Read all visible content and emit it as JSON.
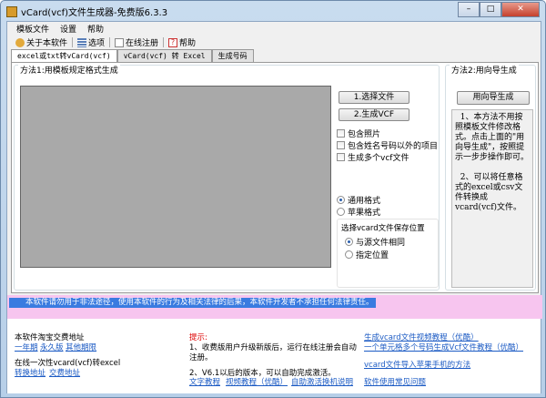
{
  "window": {
    "title": "vCard(vcf)文件生成器-免费版6.3.3",
    "min": "–",
    "max": "□",
    "close": "✕"
  },
  "menu": [
    "模板文件",
    "设置",
    "帮助"
  ],
  "toolbar": [
    "关于本软件",
    "选项",
    "在线注册",
    "帮助"
  ],
  "tabs": [
    "excel或txt转vCard(vcf)",
    "vCard(vcf) 转 Excel",
    "生成号码"
  ],
  "method1": {
    "label": "方法1:用模板规定格式生成",
    "select_file": "1.选择文件",
    "generate": "2.生成VCF",
    "checks": [
      "包含照片",
      "包含姓名号码以外的项目",
      "生成多个vcf文件"
    ],
    "formats": [
      "通用格式",
      "苹果格式"
    ],
    "save_group": "选择vcard文件保存位置",
    "save_opts": [
      "与源文件相同",
      "指定位置"
    ]
  },
  "method2": {
    "label": "方法2:用向导生成",
    "button": "用向导生成",
    "tip": "  1、本方法不用按照模板文件修改格式。点击上面的\"用向导生成\"，按照提示一步步操作即可。\n\n  2、可以将任意格式的excel或csv文件转换成vcard(vcf)文件。"
  },
  "notice": "本软件请勿用于非法途径，使用本软件的行为及相关法律的后果，本软件开发者不承担任何法律责任。",
  "footer": {
    "taobao_label": "本软件淘宝交费地址",
    "taobao_links": [
      "一年期",
      "永久版",
      "其他期限"
    ],
    "online_label": "在线一次性vcard(vcf)转excel",
    "online_links": [
      "转换地址",
      "交费地址"
    ],
    "hint_label": "提示:",
    "hint1": "1、收费版用户升级新版后，运行在线注册会自动",
    "hint1b": "注册。",
    "hint2": "2、V6.1以后的版本，可以自助完成激活。",
    "hint_links": [
      "文字教程",
      "视频教程（优酷）",
      "自助激活换机说明"
    ],
    "right_links": [
      "生成vcard文件视频教程（优酷）",
      "一个单元格多个号码生成Vcf文件教程（优酷）",
      "vcard文件导入苹果手机的方法",
      "软件使用常见问题"
    ]
  }
}
